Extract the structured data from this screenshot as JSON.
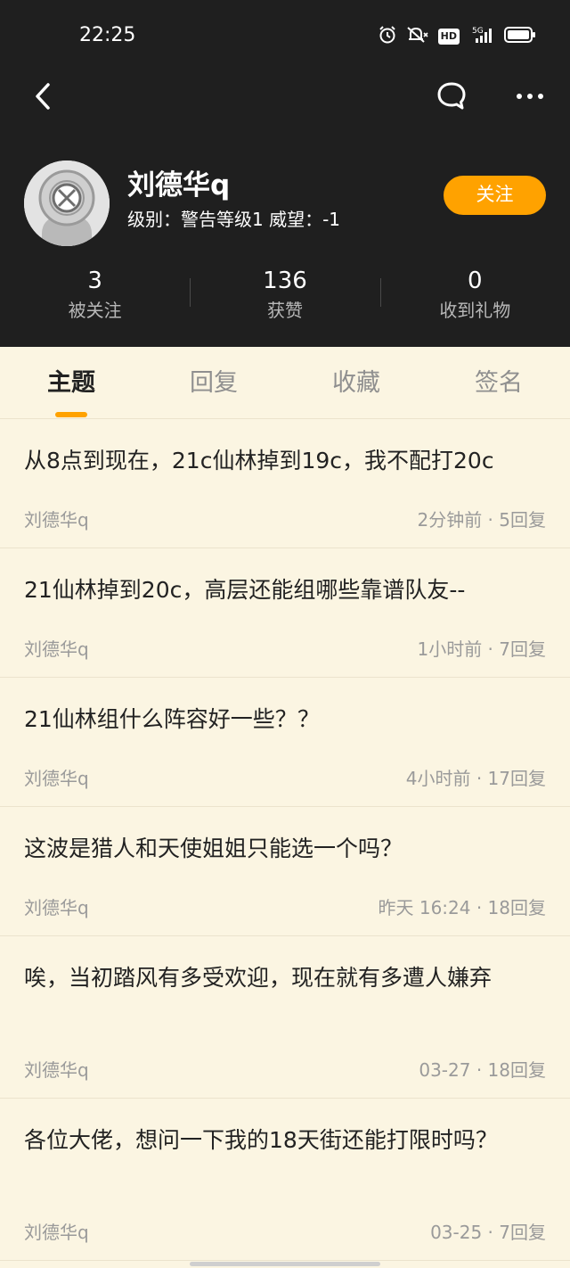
{
  "status_bar": {
    "time": "22:25",
    "icons": [
      "alarm-icon",
      "mute-icon",
      "hd-icon",
      "signal-5g-icon",
      "battery-icon"
    ],
    "hd_label": "HD"
  },
  "nav": {
    "back_icon": "back-icon",
    "chat_icon": "chat-bubble-icon",
    "more_icon": "more-icon"
  },
  "profile": {
    "username": "刘德华q",
    "level_text": "级别：警告等级1 威望：-1",
    "follow_label": "关注"
  },
  "stats": [
    {
      "value": "3",
      "label": "被关注"
    },
    {
      "value": "136",
      "label": "获赞"
    },
    {
      "value": "0",
      "label": "收到礼物"
    }
  ],
  "tabs": [
    {
      "label": "主题"
    },
    {
      "label": "回复"
    },
    {
      "label": "收藏"
    },
    {
      "label": "签名"
    }
  ],
  "posts": [
    {
      "title": "从8点到现在，21c仙林掉到19c，我不配打20c",
      "author": "刘德华q",
      "meta": "2分钟前 · 5回复"
    },
    {
      "title": "21仙林掉到20c，高层还能组哪些靠谱队友--",
      "author": "刘德华q",
      "meta": "1小时前 · 7回复"
    },
    {
      "title": "21仙林组什么阵容好一些？？",
      "author": "刘德华q",
      "meta": "4小时前 · 17回复"
    },
    {
      "title": "这波是猎人和天使姐姐只能选一个吗？",
      "author": "刘德华q",
      "meta": "昨天  16:24 · 18回复"
    },
    {
      "title": "唉，当初踏风有多受欢迎，现在就有多遭人嫌弃",
      "author": "刘德华q",
      "meta": "03-27  · 18回复"
    },
    {
      "title": "各位大佬，想问一下我的18天街还能打限时吗？",
      "author": "刘德华q",
      "meta": "03-25  · 7回复"
    }
  ],
  "colors": {
    "header_bg": "#1f1f1f",
    "accent": "#ffa200",
    "content_bg": "#fbf5e2"
  }
}
